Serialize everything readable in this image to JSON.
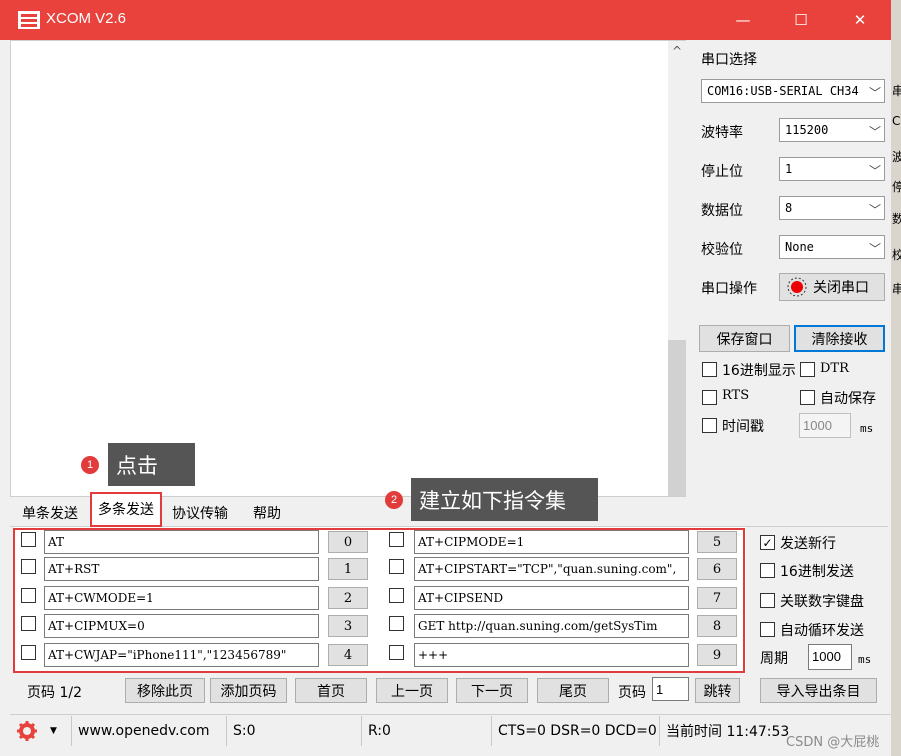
{
  "window": {
    "title": "XCOM V2.6",
    "minimize": "—",
    "maximize": "☐",
    "close": "✕"
  },
  "side": {
    "port_select_label": "串口选择",
    "port_value": "COM16:USB-SERIAL CH34",
    "baud_label": "波特率",
    "baud_value": "115200",
    "stop_label": "停止位",
    "stop_value": "1",
    "data_label": "数据位",
    "data_value": "8",
    "parity_label": "校验位",
    "parity_value": "None",
    "op_label": "串口操作",
    "close_port": "关闭串口",
    "save_window": "保存窗口",
    "clear_recv": "清除接收",
    "hex_display": "16进制显示",
    "dtr": "DTR",
    "rts": "RTS",
    "auto_save": "自动保存",
    "timestamp": "时间戳",
    "timestamp_value": "1000",
    "ms": "ms"
  },
  "tabs": [
    "单条发送",
    "多条发送",
    "协议传输",
    "帮助"
  ],
  "callouts": {
    "one_num": "1",
    "one_text": "点击",
    "two_num": "2",
    "two_text": "建立如下指令集"
  },
  "commands_left": [
    {
      "text": "AT",
      "num": "0"
    },
    {
      "text": "AT+RST",
      "num": "1"
    },
    {
      "text": "AT+CWMODE=1",
      "num": "2"
    },
    {
      "text": "AT+CIPMUX=0",
      "num": "3"
    },
    {
      "text": "AT+CWJAP=\"iPhone111\",\"123456789\"",
      "num": "4"
    }
  ],
  "commands_right": [
    {
      "text": "AT+CIPMODE=1",
      "num": "5"
    },
    {
      "text": "AT+CIPSTART=\"TCP\",\"quan.suning.com\",",
      "num": "6"
    },
    {
      "text": "AT+CIPSEND",
      "num": "7"
    },
    {
      "text": "GET http://quan.suning.com/getSysTim",
      "num": "8"
    },
    {
      "text": "+++",
      "num": "9"
    }
  ],
  "options": {
    "send_newline": "发送新行",
    "hex_send": "16进制发送",
    "numpad": "关联数字键盘",
    "loop_send": "自动循环发送",
    "period_label": "周期",
    "period_value": "1000",
    "ms": "ms"
  },
  "pager": {
    "page_label": "页码 1/2",
    "remove_page": "移除此页",
    "add_page": "添加页码",
    "first": "首页",
    "prev": "上一页",
    "next": "下一页",
    "last": "尾页",
    "page_code": "页码",
    "page_value": "1",
    "jump": "跳转",
    "import_export": "导入导出条目"
  },
  "status": {
    "url": "www.openedv.com",
    "s": "S:0",
    "r": "R:0",
    "lines": "CTS=0 DSR=0 DCD=0",
    "time": "当前时间 11:47:53",
    "watermark": "CSDN @大屁桃"
  },
  "colors": {
    "titlebar": "#e9413b",
    "highlight": "#e23b3b",
    "callout": "#555555"
  },
  "icons": {
    "logo": "app-logo-icon",
    "gear": "gear-icon",
    "port_led": "record-icon"
  }
}
